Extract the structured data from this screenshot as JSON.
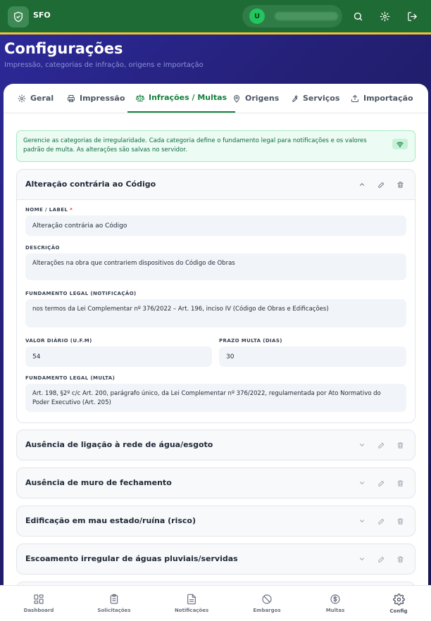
{
  "app": {
    "name": "SFO",
    "user_initial": "U"
  },
  "page": {
    "title": "Configurações",
    "subtitle": "Impressão, categorias de infração, origens e importação"
  },
  "tabs": [
    {
      "label": "Geral",
      "icon": "gear-icon"
    },
    {
      "label": "Impressão",
      "icon": "printer-icon"
    },
    {
      "label": "Infrações / Multas",
      "icon": "scale-icon",
      "active": true
    },
    {
      "label": "Origens",
      "icon": "pin-icon"
    },
    {
      "label": "Serviços",
      "icon": "wrench-icon"
    },
    {
      "label": "Importação",
      "icon": "upload-icon"
    }
  ],
  "info": {
    "text": "Gerencie as categorias de irregularidade. Cada categoria define o fundamento legal para notificações e os valores padrão de multa. As alterações são salvas no servidor."
  },
  "form_labels": {
    "name": "NOME / LABEL",
    "required_mark": "*",
    "description": "DESCRIÇÃO",
    "legal_notification": "FUNDAMENTO LEGAL (NOTIFICAÇÃO)",
    "daily_value": "VALOR DIÁRIO (U.F.M)",
    "fine_deadline": "PRAZO MULTA (DIAS)",
    "legal_fine": "FUNDAMENTO LEGAL (MULTA)"
  },
  "expanded_category": {
    "title": "Alteração contrária ao Código",
    "name": "Alteração contrária ao Código",
    "description": "Alterações na obra que contrariem dispositivos do Código de Obras",
    "legal_notification": "nos termos da Lei Complementar nº 376/2022 – Art. 196, inciso IV (Código de Obras e Edificações)",
    "daily_value": "54",
    "fine_deadline": "30",
    "legal_fine": "Art. 198, §2º c/c Art. 200, parágrafo único, da Lei Complementar nº 376/2022, regulamentada por Ato Normativo do Poder Executivo (Art. 205)"
  },
  "categories": [
    {
      "title": "Ausência de ligação à rede de água/esgoto"
    },
    {
      "title": "Ausência de muro de fechamento"
    },
    {
      "title": "Edificação em mau estado/ruína (risco)"
    },
    {
      "title": "Escoamento irregular de águas pluviais/servidas"
    }
  ],
  "bottom_nav": [
    {
      "label": "Dashboard",
      "icon": "grid-icon"
    },
    {
      "label": "Solicitações",
      "icon": "clipboard-icon"
    },
    {
      "label": "Notificações",
      "icon": "document-icon"
    },
    {
      "label": "Embargos",
      "icon": "ban-icon"
    },
    {
      "label": "Multas",
      "icon": "dollar-icon"
    },
    {
      "label": "Config",
      "icon": "gear-icon",
      "active": true
    }
  ],
  "colors": {
    "topbar": "#1f6b35",
    "accent_green": "#15803d",
    "stripe_yellow": "#f2c230",
    "background_indigo": "#2d2a9c"
  }
}
